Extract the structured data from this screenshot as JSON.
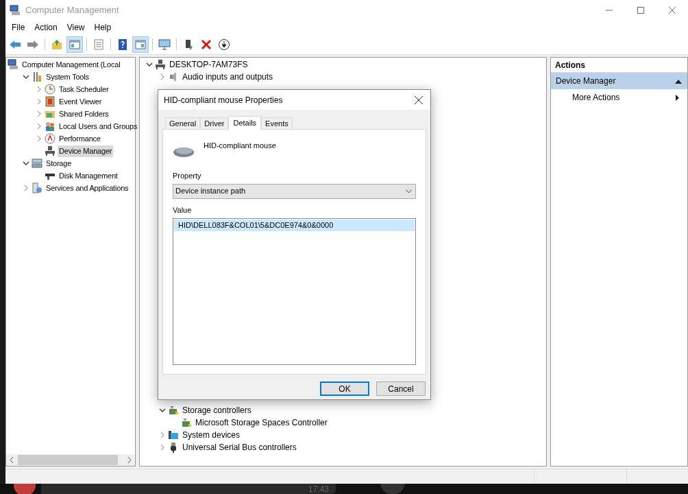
{
  "window": {
    "title": "Computer Management"
  },
  "menu": [
    "File",
    "Action",
    "View",
    "Help"
  ],
  "toolbar": [
    [
      {
        "kind": "back"
      },
      {
        "kind": "forward"
      }
    ],
    [
      {
        "kind": "up"
      },
      {
        "kind": "pane",
        "on": true
      }
    ],
    [
      {
        "kind": "list"
      }
    ],
    [
      {
        "kind": "help"
      },
      {
        "kind": "pane2",
        "on": true
      }
    ],
    [
      {
        "kind": "monitor"
      }
    ],
    [
      {
        "kind": "update"
      },
      {
        "kind": "remove"
      },
      {
        "kind": "download"
      }
    ]
  ],
  "console_tree": [
    {
      "label": "Computer Management (Local",
      "kind": "computer",
      "selected": false,
      "children": [
        {
          "label": "System Tools",
          "kind": "tools",
          "selected": false,
          "expanded": true,
          "children": [
            {
              "label": "Task Scheduler",
              "kind": "clock",
              "selected": false,
              "expanded": false
            },
            {
              "label": "Event Viewer",
              "kind": "log",
              "selected": false,
              "expanded": false
            },
            {
              "label": "Shared Folders",
              "kind": "folder",
              "selected": false,
              "expanded": false
            },
            {
              "label": "Local Users and Groups",
              "kind": "users",
              "selected": false,
              "expanded": false
            },
            {
              "label": "Performance",
              "kind": "gauge",
              "selected": false,
              "expanded": false
            },
            {
              "label": "Device Manager",
              "kind": "device",
              "selected": true
            }
          ]
        },
        {
          "label": "Storage",
          "kind": "storage",
          "selected": false,
          "expanded": true,
          "children": [
            {
              "label": "Disk Management",
              "kind": "disk",
              "selected": false
            }
          ]
        },
        {
          "label": "Services and Applications",
          "kind": "services",
          "selected": false,
          "expanded": false
        }
      ]
    }
  ],
  "device_tree": {
    "top": [
      {
        "label": "DESKTOP-7AM73FS",
        "kind": "device",
        "expanded": true
      },
      {
        "label": "Audio inputs and outputs",
        "kind": "speaker",
        "expanded": false
      }
    ],
    "bottom": [
      {
        "label": "Storage controllers",
        "kind": "controller",
        "expanded": true,
        "children": [
          {
            "label": "Microsoft Storage Spaces Controller",
            "kind": "controller"
          }
        ]
      },
      {
        "label": "System devices",
        "kind": "sysdev",
        "expanded": false
      },
      {
        "label": "Universal Serial Bus controllers",
        "kind": "usb",
        "expanded": false
      }
    ]
  },
  "actions": {
    "title": "Actions",
    "section": "Device Manager",
    "items": [
      "More Actions"
    ]
  },
  "dialog": {
    "title": "HID-compliant mouse Properties",
    "tabs": [
      {
        "label": "General",
        "selected": false
      },
      {
        "label": "Driver",
        "selected": false
      },
      {
        "label": "Details",
        "selected": true
      },
      {
        "label": "Events",
        "selected": false
      }
    ],
    "device_name": "HID-compliant mouse",
    "property_label": "Property",
    "property_value": "Device instance path",
    "value_label": "Value",
    "values": [
      {
        "text": "HID\\DELL083F&COL01\\5&DC0E974&0&0000",
        "selected": true
      }
    ],
    "buttons": [
      {
        "label": "OK",
        "default": true
      },
      {
        "label": "Cancel",
        "default": false
      }
    ]
  },
  "taskbar": {
    "clock": "17:43"
  }
}
